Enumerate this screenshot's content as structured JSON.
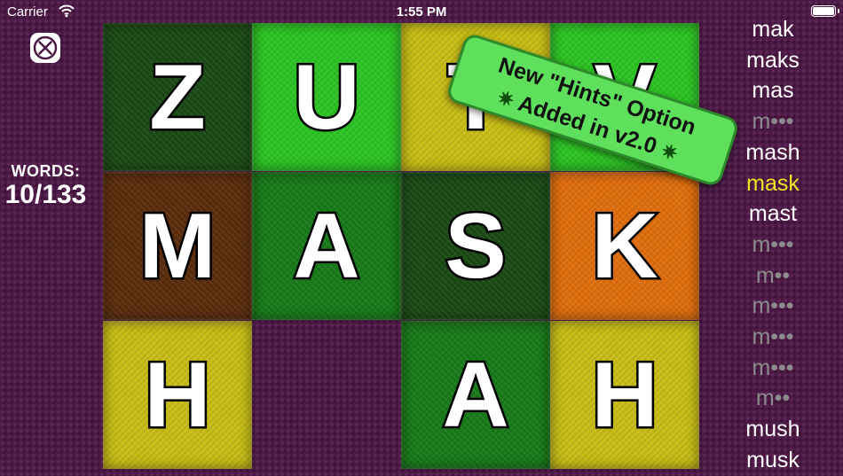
{
  "status_bar": {
    "carrier": "Carrier",
    "time": "1:55 PM",
    "wifi_icon": "wifi-icon",
    "battery_icon": "battery-icon"
  },
  "close_icon": "close-x-icon",
  "score": {
    "label": "WORDS:",
    "value": "10/133"
  },
  "board": {
    "tiles": [
      {
        "letter": "Z",
        "color": "#1a4a14"
      },
      {
        "letter": "U",
        "color": "#2bc422"
      },
      {
        "letter": "T",
        "color": "#c8bd14"
      },
      {
        "letter": "V",
        "color": "#2bc422"
      },
      {
        "letter": "M",
        "color": "#5a2c0c"
      },
      {
        "letter": "A",
        "color": "#177a18"
      },
      {
        "letter": "S",
        "color": "#1a4a14"
      },
      {
        "letter": "K",
        "color": "#e06d0c"
      },
      {
        "letter": "H",
        "color": "#c8bd14"
      },
      {
        "letter": "",
        "color": ""
      },
      {
        "letter": "A",
        "color": "#177a18"
      },
      {
        "letter": "H",
        "color": "#c8bd14"
      }
    ]
  },
  "banner": {
    "line1": "New \"Hints\" Option",
    "line2": "Added in v2.0",
    "star": "✷"
  },
  "word_list": [
    {
      "text": "mak",
      "state": "found"
    },
    {
      "text": "maks",
      "state": "found"
    },
    {
      "text": "mas",
      "state": "found"
    },
    {
      "text": "m•••",
      "state": "hidden"
    },
    {
      "text": "mash",
      "state": "found"
    },
    {
      "text": "mask",
      "state": "current"
    },
    {
      "text": "mast",
      "state": "found"
    },
    {
      "text": "m•••",
      "state": "hidden"
    },
    {
      "text": "m••",
      "state": "hidden"
    },
    {
      "text": "m•••",
      "state": "hidden"
    },
    {
      "text": "m•••",
      "state": "hidden"
    },
    {
      "text": "m•••",
      "state": "hidden"
    },
    {
      "text": "m••",
      "state": "hidden"
    },
    {
      "text": "mush",
      "state": "found"
    },
    {
      "text": "musk",
      "state": "found"
    }
  ],
  "colors": {
    "current_word": "#f2e21f",
    "hidden_word": "#8c8c8c",
    "banner": "#5fe05c"
  }
}
